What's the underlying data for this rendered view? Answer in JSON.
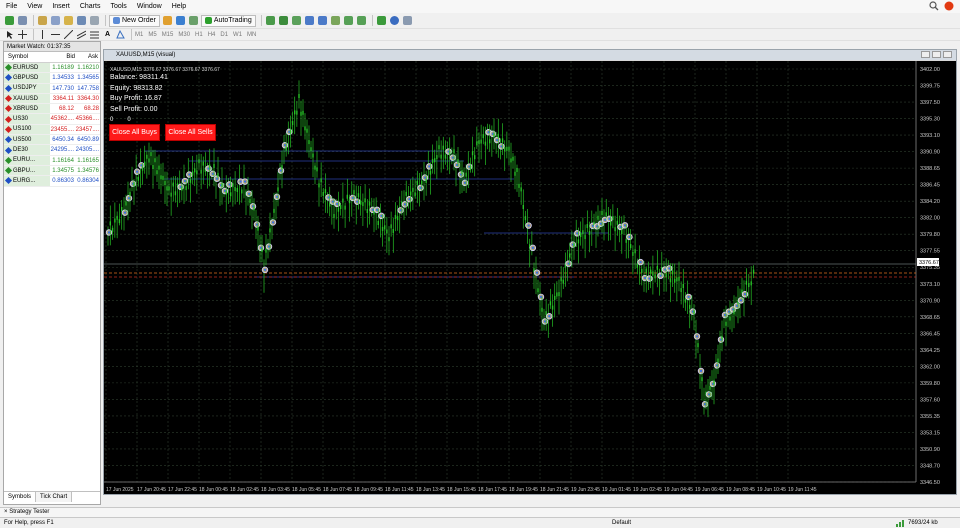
{
  "menu": [
    "File",
    "View",
    "Insert",
    "Charts",
    "Tools",
    "Window",
    "Help"
  ],
  "toolbar": {
    "new_order": "New Order",
    "autotrading": "AutoTrading",
    "timeframes": [
      "M1",
      "M5",
      "M15",
      "M30",
      "H1",
      "H4",
      "D1",
      "W1",
      "MN"
    ]
  },
  "market_watch": {
    "title": "Market Watch: 01:37:35",
    "headers": [
      "Symbol",
      "Bid",
      "Ask"
    ],
    "rows": [
      {
        "symbol": "EURUSD",
        "bid": "1.16189",
        "ask": "1.16210",
        "color": "#2a8f2a"
      },
      {
        "symbol": "GBPUSD",
        "bid": "1.34533",
        "ask": "1.34565",
        "color": "#1f4fc4"
      },
      {
        "symbol": "USDJPY",
        "bid": "147.730",
        "ask": "147.758",
        "color": "#1f4fc4"
      },
      {
        "symbol": "XAUUSD",
        "bid": "3364.11",
        "ask": "3364.30",
        "color": "#d42020"
      },
      {
        "symbol": "XBRUSD",
        "bid": "68.12",
        "ask": "68.28",
        "color": "#d42020"
      },
      {
        "symbol": "US30",
        "bid": "45362....",
        "ask": "45366....",
        "color": "#d42020"
      },
      {
        "symbol": "US100",
        "bid": "23455....",
        "ask": "23457....",
        "color": "#d42020"
      },
      {
        "symbol": "US500",
        "bid": "6450.34",
        "ask": "6450.89",
        "color": "#1f4fc4"
      },
      {
        "symbol": "DE30",
        "bid": "24295....",
        "ask": "24305....",
        "color": "#1f4fc4"
      },
      {
        "symbol": "EURU...",
        "bid": "1.16164",
        "ask": "1.16165",
        "color": "#2a8f2a"
      },
      {
        "symbol": "GBPU...",
        "bid": "1.34575",
        "ask": "1.34576",
        "color": "#2a8f2a"
      },
      {
        "symbol": "EURG...",
        "bid": "0.86303",
        "ask": "0.86304",
        "color": "#1f4fc4"
      }
    ],
    "tabs": [
      "Symbols",
      "Tick Chart"
    ]
  },
  "chart_window": {
    "title": "XAUUSD,M15 (visual)",
    "subtitle": "XAUUSD,M15  3376.67  3376.67  3376.67  3376.67",
    "balance": "Balance: 98311.41",
    "equity": "Equity: 98313.82",
    "buy_profit": "Buy Profit: 16.87",
    "sell_profit": "Sell Profit: 0.00",
    "counts": [
      "0",
      "0"
    ],
    "close_buys": "Close All Buys",
    "close_sells": "Close All Sells",
    "price_labels": [
      "3402.00",
      "3399.75",
      "3397.50",
      "3395.30",
      "3393.10",
      "3390.90",
      "3388.65",
      "3386.45",
      "3384.20",
      "3382.00",
      "3379.80",
      "3377.55",
      "3375.35",
      "3373.10",
      "3370.90",
      "3368.65",
      "3366.45",
      "3364.25",
      "3362.00",
      "3359.80",
      "3357.60",
      "3355.35",
      "3353.15",
      "3350.90",
      "3348.70",
      "3346.50"
    ],
    "time_labels": [
      "17 Jun 2025",
      "17 Jun 20:45",
      "17 Jun 22:45",
      "18 Jun 00:45",
      "18 Jun 02:45",
      "18 Jun 03:45",
      "18 Jun 05:45",
      "18 Jun 07:45",
      "18 Jun 09:45",
      "18 Jun 11:45",
      "18 Jun 13:45",
      "18 Jun 15:45",
      "18 Jun 17:45",
      "18 Jun 19:45",
      "18 Jun 21:45",
      "19 Jun 23:45",
      "19 Jun 01:45",
      "19 Jun 02:45",
      "19 Jun 04:45",
      "19 Jun 06:45",
      "19 Jun 08:45",
      "19 Jun 10:45",
      "19 Jun 11:45"
    ],
    "current_price": "3376.67",
    "bg_color": "#000000",
    "grid_color": "#2e3d2e",
    "candle_color": "#27c227"
  },
  "status": {
    "strategy_tester": "Strategy Tester",
    "help": "For Help, press F1",
    "profile": "Default",
    "traffic": "7693/24 kb"
  }
}
